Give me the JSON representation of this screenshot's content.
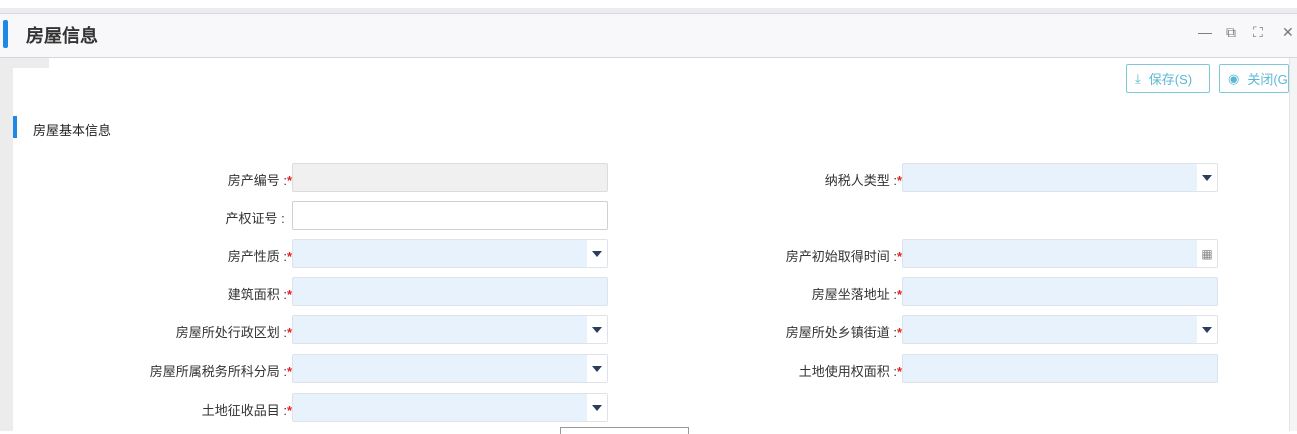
{
  "header": {
    "title": "房屋信息"
  },
  "toolbar": {
    "save": "保存(S)",
    "close": "关闭(G"
  },
  "section": {
    "title": "房屋基本信息"
  },
  "fields_left": [
    {
      "label": "房产编号 :",
      "required": true,
      "type": "disabled"
    },
    {
      "label": "产权证号 :",
      "required": false,
      "type": "text"
    },
    {
      "label": "房产性质 :",
      "required": true,
      "type": "select"
    },
    {
      "label": "建筑面积 :",
      "required": true,
      "type": "input"
    },
    {
      "label": "房屋所处行政区划 :",
      "required": true,
      "type": "select"
    },
    {
      "label": "房屋所属税务所科分局 :",
      "required": true,
      "type": "select"
    },
    {
      "label": "土地征收品目 :",
      "required": true,
      "type": "select"
    }
  ],
  "fields_right": [
    {
      "label": "纳税人类型 :",
      "required": true,
      "type": "select"
    },
    {
      "label": "房产初始取得时间 :",
      "required": true,
      "type": "date"
    },
    {
      "label": "房屋坐落地址 :",
      "required": true,
      "type": "input"
    },
    {
      "label": "房屋所处乡镇街道 :",
      "required": true,
      "type": "select"
    },
    {
      "label": "土地使用权面积 :",
      "required": true,
      "type": "input"
    }
  ],
  "required_mark": "*"
}
